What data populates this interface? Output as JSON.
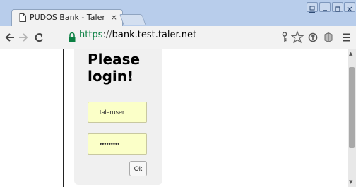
{
  "browser": {
    "tab": {
      "title": "PUDOS Bank - Taler De",
      "close_glyph": "×",
      "icon": "document-icon"
    },
    "address": {
      "scheme": "https",
      "separator": "://",
      "host": "bank.test.taler.net"
    },
    "toolbar_icons": [
      "back-arrow-icon",
      "forward-arrow-icon",
      "reload-icon",
      "lock-icon",
      "key-icon",
      "star-icon",
      "extension-icon",
      "extension-icon",
      "menu-icon"
    ]
  },
  "page": {
    "heading": "Please login!",
    "username_value": "taleruser",
    "password_value": "•••••••••",
    "ok_label": "Ok"
  },
  "colors": {
    "tab_bar": "#b8cdeb",
    "toolbar": "#f2f2f2",
    "secure_scheme": "#0b8043",
    "input_background": "#fbffc8",
    "card_background": "#f0f0f0"
  }
}
